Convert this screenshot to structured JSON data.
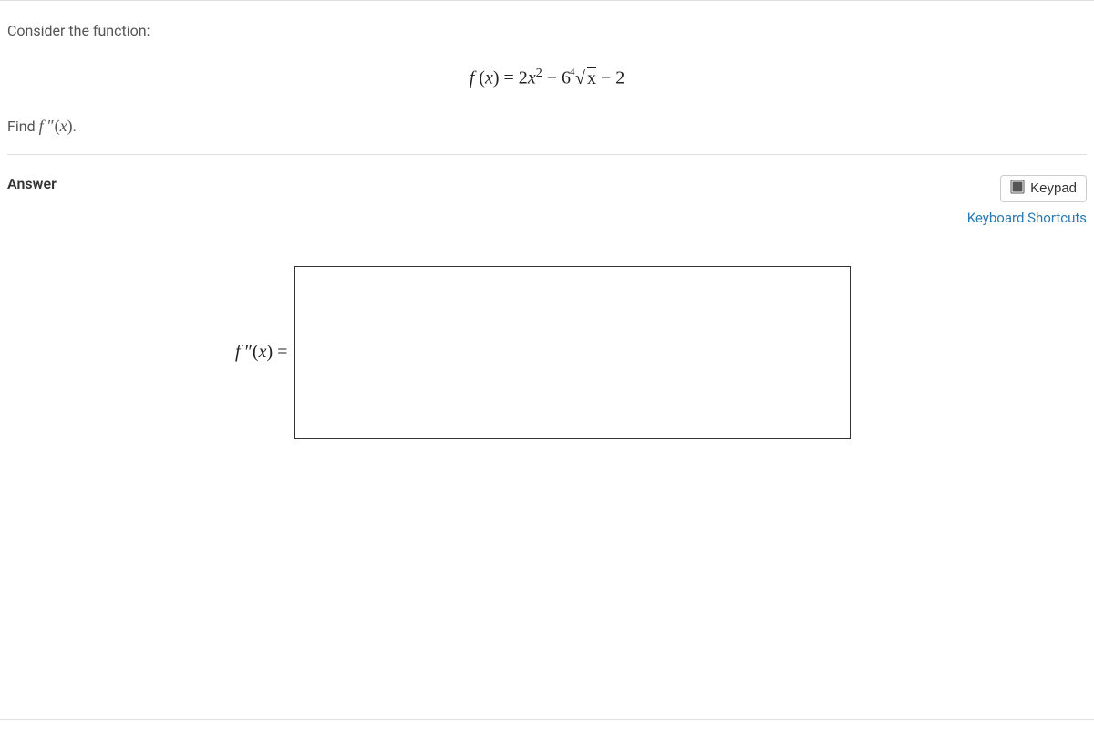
{
  "question": {
    "intro": "Consider the function:",
    "equation_plain": "f(x) = 2x^2 − 6 ⁴√x − 2",
    "find_prefix": "Find ",
    "find_math": "f ″(x)",
    "find_suffix": "."
  },
  "answer": {
    "section_label": "Answer",
    "keypad_label": "Keypad",
    "shortcuts_label": "Keyboard Shortcuts",
    "input_label": "f ″(x) =",
    "input_value": ""
  }
}
